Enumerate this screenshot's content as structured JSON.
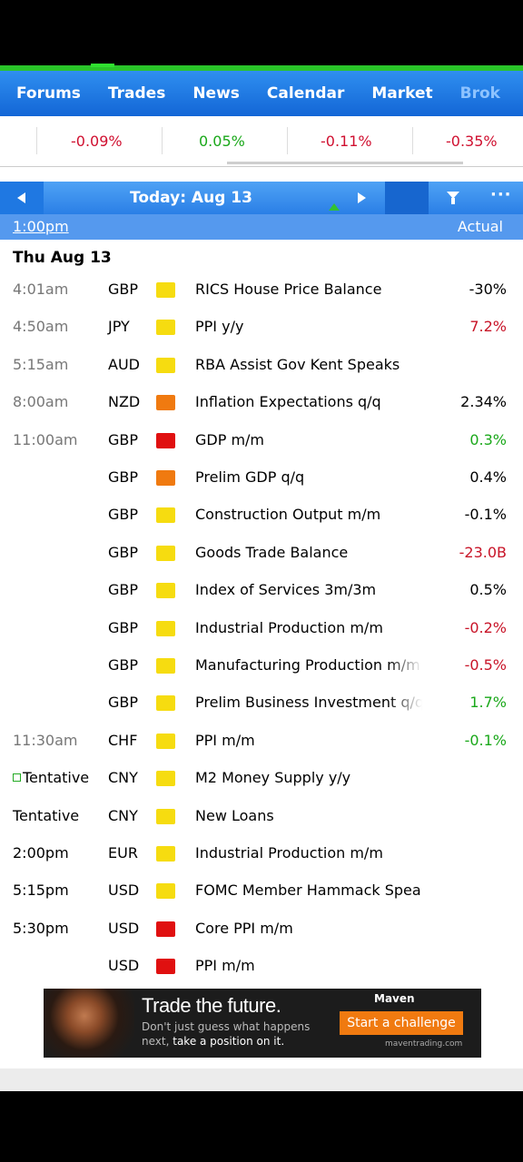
{
  "nav": {
    "items": [
      "Forums",
      "Trades",
      "News",
      "Calendar",
      "Market",
      "Brok"
    ]
  },
  "tickers": [
    "-0.09%",
    "0.05%",
    "-0.11%",
    "-0.35%"
  ],
  "ticker_colors": [
    "#d01030",
    "#1aa81a",
    "#d01030",
    "#d01030"
  ],
  "date_bar": {
    "title": "Today: Aug 13",
    "more": "···"
  },
  "time_bar": {
    "current_time": "1:00pm",
    "actual_header": "Actual"
  },
  "day_header": "Thu Aug 13",
  "events": [
    {
      "time": "4:01am",
      "time_style": "past",
      "currency": "GBP",
      "impact": "yellow",
      "event": "RICS House Price Balance",
      "actual": "-30%",
      "actual_color": "black"
    },
    {
      "time": "4:50am",
      "time_style": "past",
      "currency": "JPY",
      "impact": "yellow",
      "event": "PPI y/y",
      "actual": "7.2%",
      "actual_color": "red"
    },
    {
      "time": "5:15am",
      "time_style": "past",
      "currency": "AUD",
      "impact": "yellow",
      "event": "RBA Assist Gov Kent Speaks",
      "actual": "",
      "actual_color": "black"
    },
    {
      "time": "8:00am",
      "time_style": "past",
      "currency": "NZD",
      "impact": "orange",
      "event": "Inflation Expectations q/q",
      "actual": "2.34%",
      "actual_color": "black"
    },
    {
      "time": "11:00am",
      "time_style": "past",
      "currency": "GBP",
      "impact": "red",
      "event": "GDP m/m",
      "actual": "0.3%",
      "actual_color": "green"
    },
    {
      "time": "",
      "time_style": "past",
      "currency": "GBP",
      "impact": "orange",
      "event": "Prelim GDP q/q",
      "actual": "0.4%",
      "actual_color": "black"
    },
    {
      "time": "",
      "time_style": "past",
      "currency": "GBP",
      "impact": "yellow",
      "event": "Construction Output m/m",
      "actual": "-0.1%",
      "actual_color": "black"
    },
    {
      "time": "",
      "time_style": "past",
      "currency": "GBP",
      "impact": "yellow",
      "event": "Goods Trade Balance",
      "actual": "-23.0B",
      "actual_color": "red"
    },
    {
      "time": "",
      "time_style": "past",
      "currency": "GBP",
      "impact": "yellow",
      "event": "Index of Services 3m/3m",
      "actual": "0.5%",
      "actual_color": "black"
    },
    {
      "time": "",
      "time_style": "past",
      "currency": "GBP",
      "impact": "yellow",
      "event": "Industrial Production m/m",
      "actual": "-0.2%",
      "actual_color": "red"
    },
    {
      "time": "",
      "time_style": "past",
      "currency": "GBP",
      "impact": "yellow",
      "event": "Manufacturing Production m/m",
      "actual": "-0.5%",
      "actual_color": "red"
    },
    {
      "time": "",
      "time_style": "past",
      "currency": "GBP",
      "impact": "yellow",
      "event": "Prelim Business Investment q/q",
      "actual": "1.7%",
      "actual_color": "green"
    },
    {
      "time": "11:30am",
      "time_style": "past",
      "currency": "CHF",
      "impact": "yellow",
      "event": "PPI m/m",
      "actual": "-0.1%",
      "actual_color": "green"
    },
    {
      "time": "Tentative",
      "time_style": "current",
      "currency": "CNY",
      "impact": "yellow",
      "event": "M2 Money Supply y/y",
      "actual": "",
      "actual_color": "black"
    },
    {
      "time": "Tentative",
      "time_style": "future",
      "currency": "CNY",
      "impact": "yellow",
      "event": "New Loans",
      "actual": "",
      "actual_color": "black"
    },
    {
      "time": "2:00pm",
      "time_style": "future",
      "currency": "EUR",
      "impact": "yellow",
      "event": "Industrial Production m/m",
      "actual": "",
      "actual_color": "black"
    },
    {
      "time": "5:15pm",
      "time_style": "future",
      "currency": "USD",
      "impact": "yellow",
      "event": "FOMC Member Hammack Speaks",
      "actual": "",
      "actual_color": "black"
    },
    {
      "time": "5:30pm",
      "time_style": "future",
      "currency": "USD",
      "impact": "red",
      "event": "Core PPI m/m",
      "actual": "",
      "actual_color": "black"
    },
    {
      "time": "",
      "time_style": "future",
      "currency": "USD",
      "impact": "red",
      "event": "PPI m/m",
      "actual": "",
      "actual_color": "black"
    }
  ],
  "ad": {
    "title": "Trade the future.",
    "line1": "Don't just guess what happens",
    "line2_prefix": "next,",
    "line2_emphasis": "take a position on it.",
    "brand": "Maven",
    "cta": "Start a challenge",
    "url": "maventrading.com"
  }
}
